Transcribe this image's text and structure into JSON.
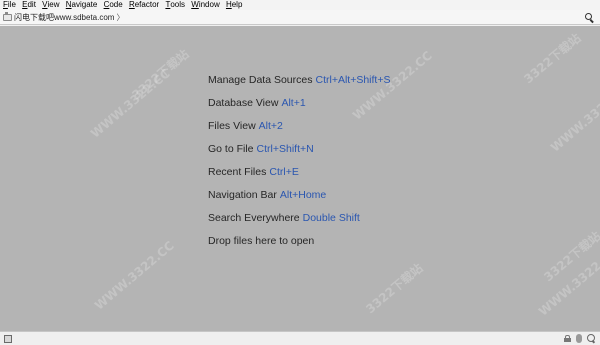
{
  "menu": [
    {
      "key": "F",
      "rest": "ile"
    },
    {
      "key": "E",
      "rest": "dit"
    },
    {
      "key": "V",
      "rest": "iew"
    },
    {
      "key": "N",
      "rest": "avigate"
    },
    {
      "key": "C",
      "rest": "ode"
    },
    {
      "key": "R",
      "rest": "efactor"
    },
    {
      "key": "T",
      "rest": "ools"
    },
    {
      "key": "W",
      "rest": "indow"
    },
    {
      "key": "H",
      "rest": "elp"
    }
  ],
  "navbar": {
    "project": "闪电下载吧www.sdbeta.com",
    "separator": "〉",
    "search_icon": "search-icon"
  },
  "hints": [
    {
      "label": "Manage Data Sources",
      "shortcut": "Ctrl+Alt+Shift+S"
    },
    {
      "label": "Database View",
      "shortcut": "Alt+1"
    },
    {
      "label": "Files View",
      "shortcut": "Alt+2"
    },
    {
      "label": "Go to File",
      "shortcut": "Ctrl+Shift+N"
    },
    {
      "label": "Recent Files",
      "shortcut": "Ctrl+E"
    },
    {
      "label": "Navigation Bar",
      "shortcut": "Alt+Home"
    },
    {
      "label": "Search Everywhere",
      "shortcut": "Double Shift"
    },
    {
      "label": "Drop files here to open",
      "shortcut": ""
    }
  ],
  "watermark": "WWW.3322.CC",
  "watermark_logo": "3322下载站",
  "colors": {
    "editor_bg": "#b4b4b4",
    "shortcut": "#2a56b0"
  },
  "statusbar": {
    "icons": [
      "tool-window-toggle-icon",
      "lock-icon",
      "memory-indicator-icon",
      "inspector-icon"
    ]
  }
}
